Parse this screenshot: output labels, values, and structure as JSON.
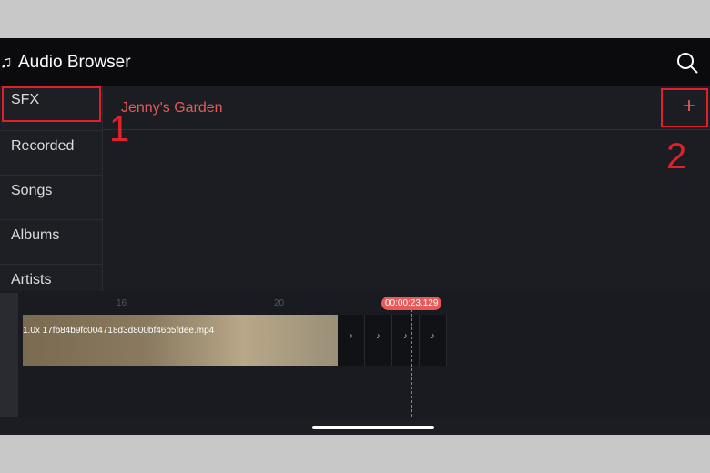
{
  "header": {
    "title": "Audio Browser",
    "icon": "music-note-icon",
    "search_icon": "search-icon"
  },
  "sidebar": {
    "items": [
      {
        "label": "SFX"
      },
      {
        "label": "Recorded"
      },
      {
        "label": "Songs"
      },
      {
        "label": "Albums"
      },
      {
        "label": "Artists"
      }
    ]
  },
  "list": {
    "items": [
      {
        "label": "Jenny's Garden"
      }
    ],
    "add_label": "+"
  },
  "annotations": {
    "one": "1",
    "two": "2"
  },
  "timeline": {
    "ruler_marks": [
      "16",
      "20"
    ],
    "playhead_time": "00:00:23.129",
    "clip_label": "1.0x 17fb84b9fc004718d3d800bf46b5fdee.mp4",
    "audio_glyph": "♪"
  }
}
